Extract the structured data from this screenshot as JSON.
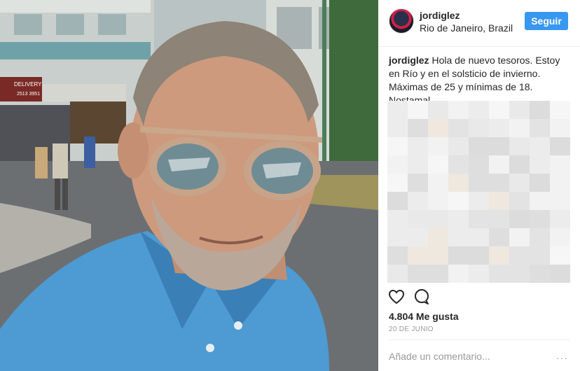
{
  "post": {
    "username": "jordiglez",
    "location": "Rio de Janeiro, Brazil",
    "follow_label": "Seguir",
    "caption_user": "jordiglez",
    "caption_text": "Hola de nuevo tesoros. Estoy en Río y en el solsticio de invierno. Máximas de 25 y mínimas de 18. Nostamal.",
    "likes": "4.804 Me gusta",
    "date": "20 DE JUNIO",
    "comment_placeholder": "Añade un comentario...",
    "more": "···"
  },
  "photo": {
    "shop_sign": "DELIVERY",
    "shop_phone": "2513 3951"
  },
  "colors": {
    "accent": "#3897f0",
    "shirt": "#4d9bd2"
  },
  "icons": [
    "heart-icon",
    "comment-icon",
    "more-options-icon"
  ]
}
